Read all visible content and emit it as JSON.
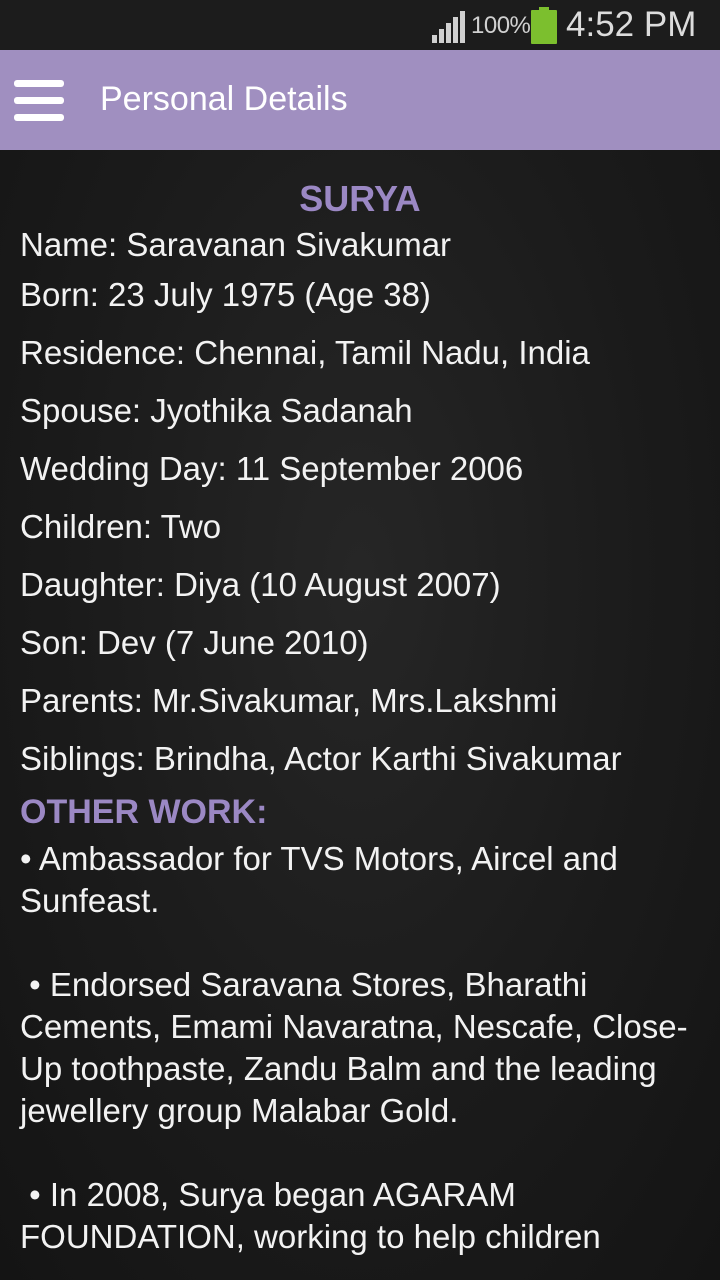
{
  "status_bar": {
    "battery_percent": "100%",
    "time": "4:52 PM",
    "battery_color": "#7cbf2e"
  },
  "app_bar": {
    "title": "Personal Details",
    "color": "#a08fc0",
    "menu_icon": "hamburger-menu-icon"
  },
  "profile": {
    "heading": "SURYA",
    "details": [
      "Name: Saravanan Sivakumar",
      "Born: 23 July 1975 (Age 38)",
      "Residence: Chennai, Tamil Nadu, India",
      "Spouse: Jyothika Sadanah",
      "Wedding Day: 11 September 2006",
      "Children: Two",
      "Daughter: Diya (10 August 2007)",
      "Son: Dev (7 June 2010)",
      "Parents: Mr.Sivakumar, Mrs.Lakshmi",
      "Siblings: Brindha, Actor Karthi Sivakumar"
    ],
    "other_work_title": "OTHER WORK:",
    "other_work": [
      "• Ambassador for TVS Motors, Aircel and Sunfeast.",
      " • Endorsed Saravana Stores, Bharathi Cements, Emami Navaratna, Nescafe, Close-Up toothpaste, Zandu Balm and the leading jewellery group Malabar Gold.",
      " • In 2008, Surya began AGARAM FOUNDATION, working to help children"
    ],
    "accent_color": "#9b88c4"
  }
}
